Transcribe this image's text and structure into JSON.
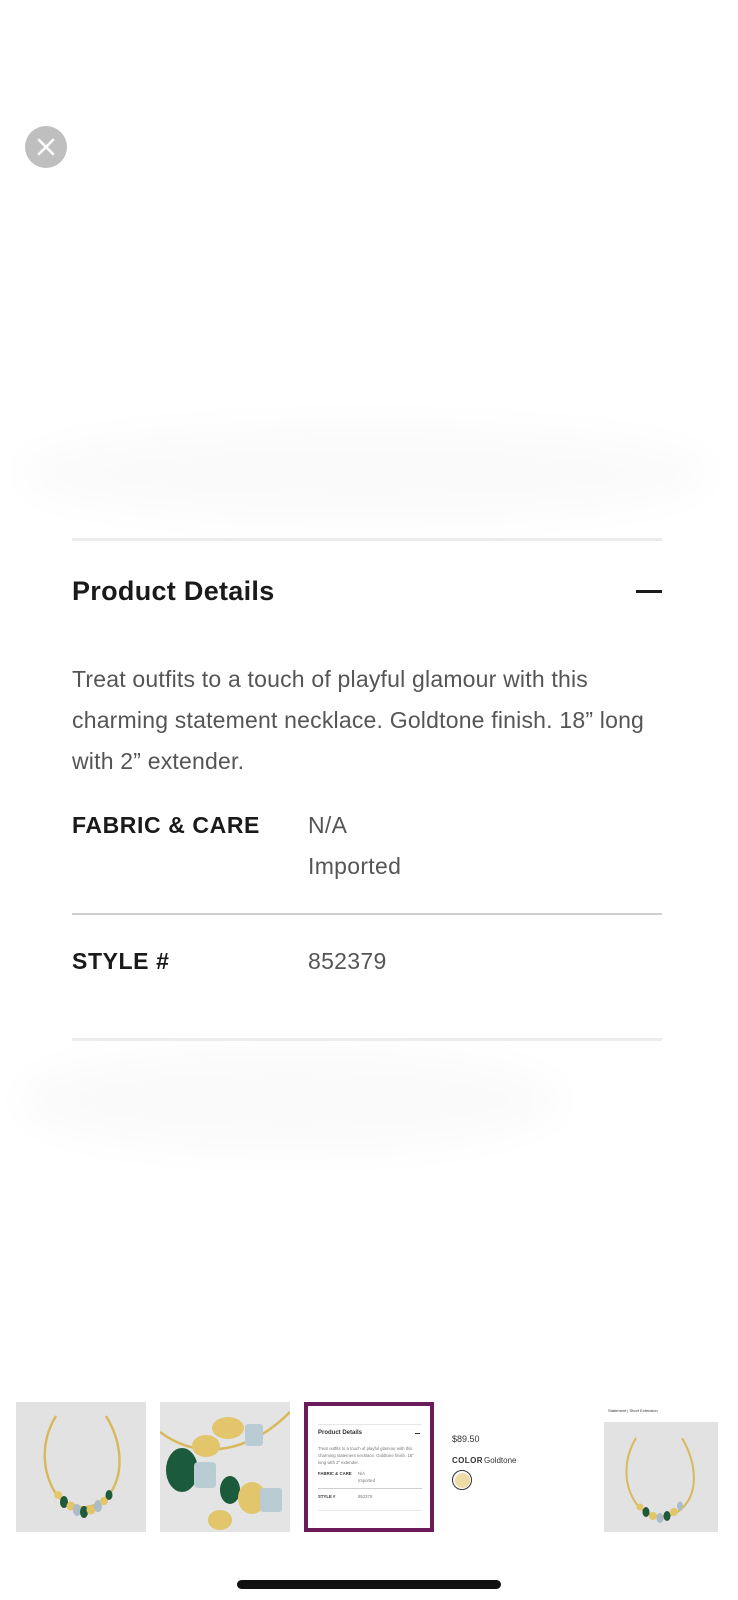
{
  "close_button": {
    "icon": "close-icon"
  },
  "product_details": {
    "title": "Product Details",
    "toggle_icon": "minus-icon",
    "description": "Treat outfits to a touch of playful glamour with this charming statement necklace. Goldtone finish. 18” long with 2” extender.",
    "specs": [
      {
        "label": "FABRIC & CARE",
        "values": [
          "N/A",
          "Imported"
        ]
      },
      {
        "label": "STYLE #",
        "values": [
          "852379"
        ]
      }
    ]
  },
  "thumbnails": {
    "selected_index": 2,
    "items": [
      {
        "kind": "photo",
        "alt": "necklace-full"
      },
      {
        "kind": "photo",
        "alt": "necklace-closeup"
      },
      {
        "kind": "details-preview",
        "title": "Product Details",
        "description": "Treat outfits to a touch of playful glamour with this charming statement necklace. Goldtone finish. 18” long with 2” extender.",
        "fabric_label": "FABRIC & CARE",
        "fabric_value_1": "N/A",
        "fabric_value_2": "Imported",
        "style_label": "STYLE #",
        "style_value": "852379"
      },
      {
        "kind": "price-preview",
        "price": "$89.50",
        "color_label": "COLOR",
        "color_value": "Goldtone",
        "swatch_color": "#eedba6"
      },
      {
        "kind": "photo",
        "alt": "necklace-tab-preview",
        "header_text": "Statement | Short Extension"
      }
    ]
  },
  "colors": {
    "accent": "#6b1a5a",
    "close_bg": "#bfbfbf"
  }
}
